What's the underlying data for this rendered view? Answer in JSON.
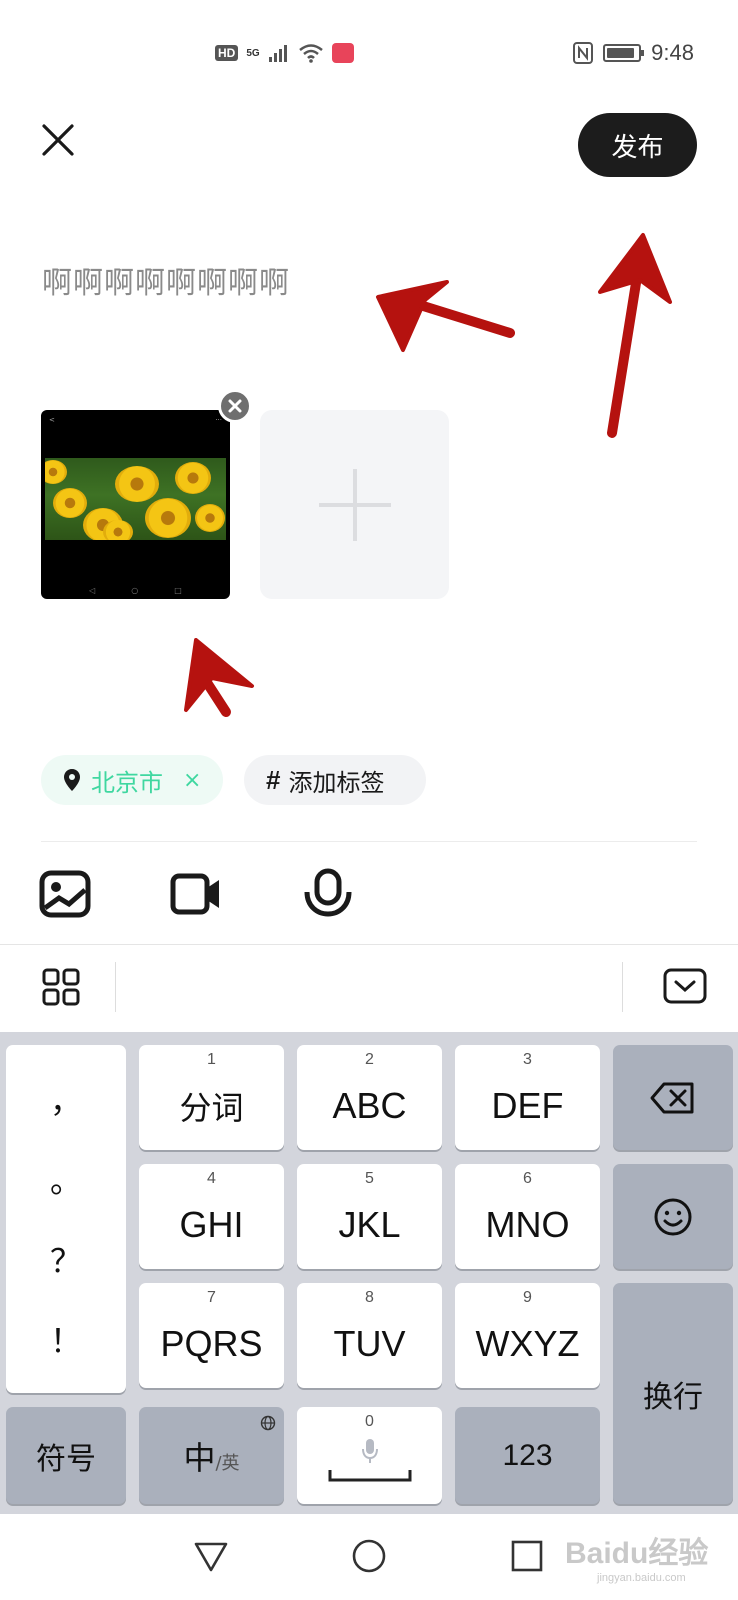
{
  "status_bar": {
    "hd": "HD",
    "network": "5G",
    "time": "9:48",
    "icons": [
      "hd-icon",
      "signal-icon",
      "wifi-icon",
      "calendar-app-icon",
      "nfc-icon",
      "battery-icon"
    ]
  },
  "header": {
    "close_icon": "close-icon",
    "publish_label": "发布"
  },
  "post": {
    "text": "啊啊啊啊啊啊啊啊"
  },
  "images": {
    "add_icon": "plus-icon",
    "remove_icon": "close-icon"
  },
  "tags": {
    "location": "北京市",
    "location_clear": "×",
    "hash": "#",
    "add_tag": "添加标签"
  },
  "media_toolbar": {
    "icons": [
      "image-icon",
      "video-icon",
      "microphone-icon"
    ]
  },
  "keyboard": {
    "toolbar_icons": [
      "grid-menu-icon",
      "collapse-keyboard-icon"
    ],
    "punctuation": [
      "，",
      "。",
      "？",
      "！"
    ],
    "keys": [
      {
        "num": "1",
        "label": "分词"
      },
      {
        "num": "2",
        "label": "ABC"
      },
      {
        "num": "3",
        "label": "DEF"
      },
      {
        "num": "4",
        "label": "GHI"
      },
      {
        "num": "5",
        "label": "JKL"
      },
      {
        "num": "6",
        "label": "MNO"
      },
      {
        "num": "7",
        "label": "PQRS"
      },
      {
        "num": "8",
        "label": "TUV"
      },
      {
        "num": "9",
        "label": "WXYZ"
      }
    ],
    "symbols": "符号",
    "lang_main": "中",
    "lang_alt": "/英",
    "space_num": "0",
    "numeric": "123",
    "enter": "换行"
  },
  "navbar": {
    "icons": [
      "back-triangle-icon",
      "home-circle-icon",
      "recents-square-icon"
    ]
  },
  "watermark": {
    "brand": "Baidu经验",
    "url": "jingyan.baidu.com"
  },
  "colors": {
    "accent_green": "#3fd7a0",
    "annotation_red": "#b5120f",
    "publish_bg": "#1c1c1c",
    "keyboard_bg": "#d3d5dc"
  }
}
